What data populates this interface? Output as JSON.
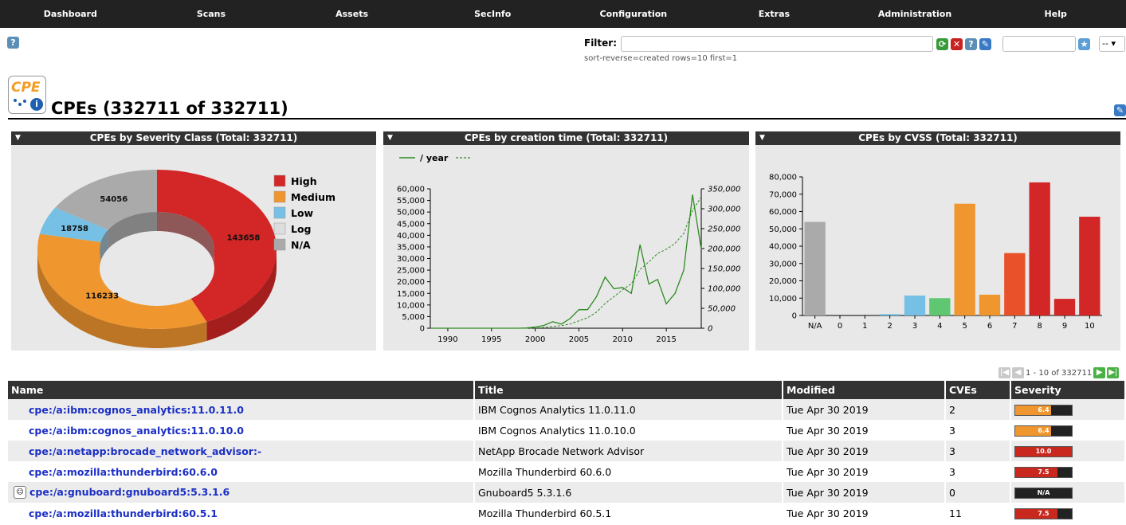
{
  "nav": [
    "Dashboard",
    "Scans",
    "Assets",
    "SecInfo",
    "Configuration",
    "Extras",
    "Administration",
    "Help"
  ],
  "filter": {
    "label": "Filter:",
    "value": "",
    "sub": "sort-reverse=created rows=10 first=1",
    "select_value": "--"
  },
  "page": {
    "title": "CPEs (332711 of 332711)",
    "logo_text": "CPE"
  },
  "colors": {
    "high": "#d32626",
    "medium": "#f0962f",
    "low": "#75c0e4",
    "log": "#dddddd",
    "na": "#aaaaaa",
    "cvss4": "#5fc772",
    "cvss7": "#e8512a",
    "line": "#2e8b22"
  },
  "panels": {
    "severity_title": "CPEs by Severity Class (Total: 332711)",
    "time_title": "CPEs by creation time (Total: 332711)",
    "cvss_title": "CPEs by CVSS (Total: 332711)"
  },
  "chart_data": [
    {
      "type": "pie",
      "title": "CPEs by Severity Class (Total: 332711)",
      "labels": [
        "High",
        "Medium",
        "Low",
        "Log",
        "N/A"
      ],
      "values": [
        143658,
        116233,
        18758,
        6,
        54056
      ],
      "legend": "right"
    },
    {
      "type": "line",
      "title": "CPEs by creation time (Total: 332711)",
      "legend": [
        "/ year",
        ""
      ],
      "x": [
        1988,
        1990,
        1992,
        1994,
        1996,
        1998,
        1999,
        2000,
        2001,
        2002,
        2003,
        2004,
        2005,
        2006,
        2007,
        2008,
        2009,
        2010,
        2011,
        2012,
        2013,
        2014,
        2015,
        2016,
        2017,
        2018,
        2019
      ],
      "x_ticks": [
        1990,
        1995,
        2000,
        2005,
        2010,
        2015
      ],
      "series": [
        {
          "name": "/ year",
          "axis": "left",
          "style": "solid",
          "values": [
            0,
            0,
            0,
            0,
            0,
            0,
            100,
            500,
            1200,
            2800,
            1800,
            4200,
            8000,
            8000,
            13500,
            22000,
            17000,
            17500,
            15000,
            36000,
            19000,
            21000,
            10500,
            15000,
            25000,
            57500,
            34000
          ]
        },
        {
          "name": "",
          "axis": "right",
          "style": "dashed",
          "values": [
            0,
            0,
            0,
            0,
            0,
            0,
            100,
            600,
            1800,
            4600,
            6400,
            10600,
            18600,
            26600,
            40100,
            62100,
            79100,
            96600,
            111600,
            147600,
            166600,
            187600,
            198100,
            213100,
            238100,
            295600,
            329600
          ]
        }
      ],
      "ylim_left": [
        0,
        60000
      ],
      "yticks_left": [
        "0",
        "5,000",
        "10,000",
        "15,000",
        "20,000",
        "25,000",
        "30,000",
        "35,000",
        "40,000",
        "45,000",
        "50,000",
        "55,000",
        "60,000"
      ],
      "ylim_right": [
        0,
        350000
      ],
      "yticks_right": [
        "0",
        "50,000",
        "100,000",
        "150,000",
        "200,000",
        "250,000",
        "300,000",
        "350,000"
      ]
    },
    {
      "type": "bar",
      "title": "CPEs by CVSS (Total: 332711)",
      "categories": [
        "N/A",
        "0",
        "1",
        "2",
        "3",
        "4",
        "5",
        "6",
        "7",
        "8",
        "9",
        "10"
      ],
      "values": [
        54000,
        0,
        0,
        800,
        11500,
        10000,
        64500,
        12000,
        36000,
        76800,
        9600,
        57000
      ],
      "ylim": [
        0,
        80000
      ],
      "yticks": [
        "0",
        "10,000",
        "20,000",
        "30,000",
        "40,000",
        "50,000",
        "60,000",
        "70,000",
        "80,000"
      ]
    }
  ],
  "pager": {
    "text": "1 - 10 of 332711"
  },
  "table": {
    "headers": [
      "Name",
      "Title",
      "Modified",
      "CVEs",
      "Severity"
    ],
    "rows": [
      {
        "name": "cpe:/a:ibm:cognos_analytics:11.0.11.0",
        "title": "IBM Cognos Analytics 11.0.11.0",
        "modified": "Tue Apr 30 2019",
        "cves": "2",
        "severity": "6.4",
        "sev_value": 6.4,
        "icon": false
      },
      {
        "name": "cpe:/a:ibm:cognos_analytics:11.0.10.0",
        "title": "IBM Cognos Analytics 11.0.10.0",
        "modified": "Tue Apr 30 2019",
        "cves": "3",
        "severity": "6.4",
        "sev_value": 6.4,
        "icon": false
      },
      {
        "name": "cpe:/a:netapp:brocade_network_advisor:-",
        "title": "NetApp Brocade Network Advisor",
        "modified": "Tue Apr 30 2019",
        "cves": "3",
        "severity": "10.0",
        "sev_value": 10.0,
        "icon": false
      },
      {
        "name": "cpe:/a:mozilla:thunderbird:60.6.0",
        "title": "Mozilla Thunderbird 60.6.0",
        "modified": "Tue Apr 30 2019",
        "cves": "3",
        "severity": "7.5",
        "sev_value": 7.5,
        "icon": false
      },
      {
        "name": "cpe:/a:gnuboard:gnuboard5:5.3.1.6",
        "title": "Gnuboard5 5.3.1.6",
        "modified": "Tue Apr 30 2019",
        "cves": "0",
        "severity": "N/A",
        "sev_value": 0,
        "icon": true
      },
      {
        "name": "cpe:/a:mozilla:thunderbird:60.5.1",
        "title": "Mozilla Thunderbird 60.5.1",
        "modified": "Tue Apr 30 2019",
        "cves": "11",
        "severity": "7.5",
        "sev_value": 7.5,
        "icon": false
      }
    ]
  }
}
